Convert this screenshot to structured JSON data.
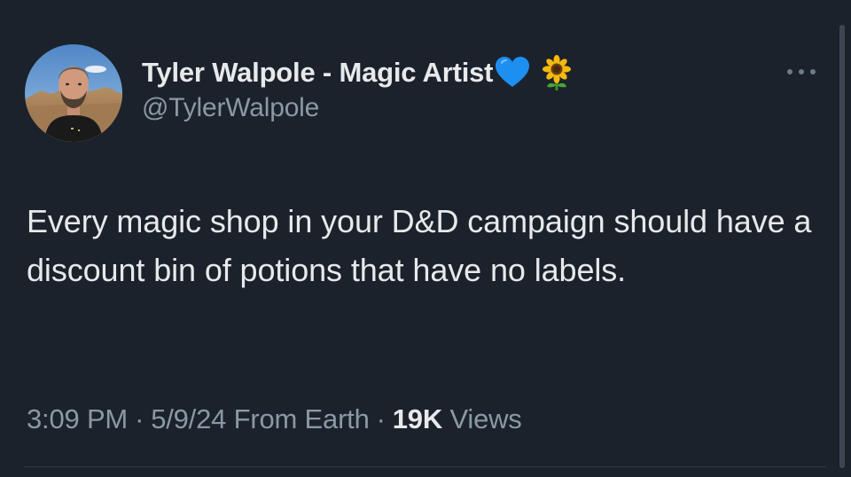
{
  "author": {
    "display_name": "Tyler Walpole - Magic Artist",
    "handle": "@TylerWalpole",
    "name_emojis": [
      "blue-heart",
      "sunflower"
    ]
  },
  "tweet": {
    "text": "Every magic shop in your D&D campaign should have a discount bin of potions that have no labels.",
    "time": "3:09 PM",
    "date": "5/9/24",
    "location": "From Earth",
    "views_count": "19K",
    "views_label": "Views",
    "separator": "·"
  },
  "icons": {
    "more": "more-horizontal-icon",
    "heart": "blue-heart-icon",
    "sunflower": "sunflower-icon"
  },
  "colors": {
    "background": "#1b222c",
    "primary_text": "#e7e9ea",
    "secondary_text": "#8b98a5",
    "heart": "#1d8ff0"
  }
}
